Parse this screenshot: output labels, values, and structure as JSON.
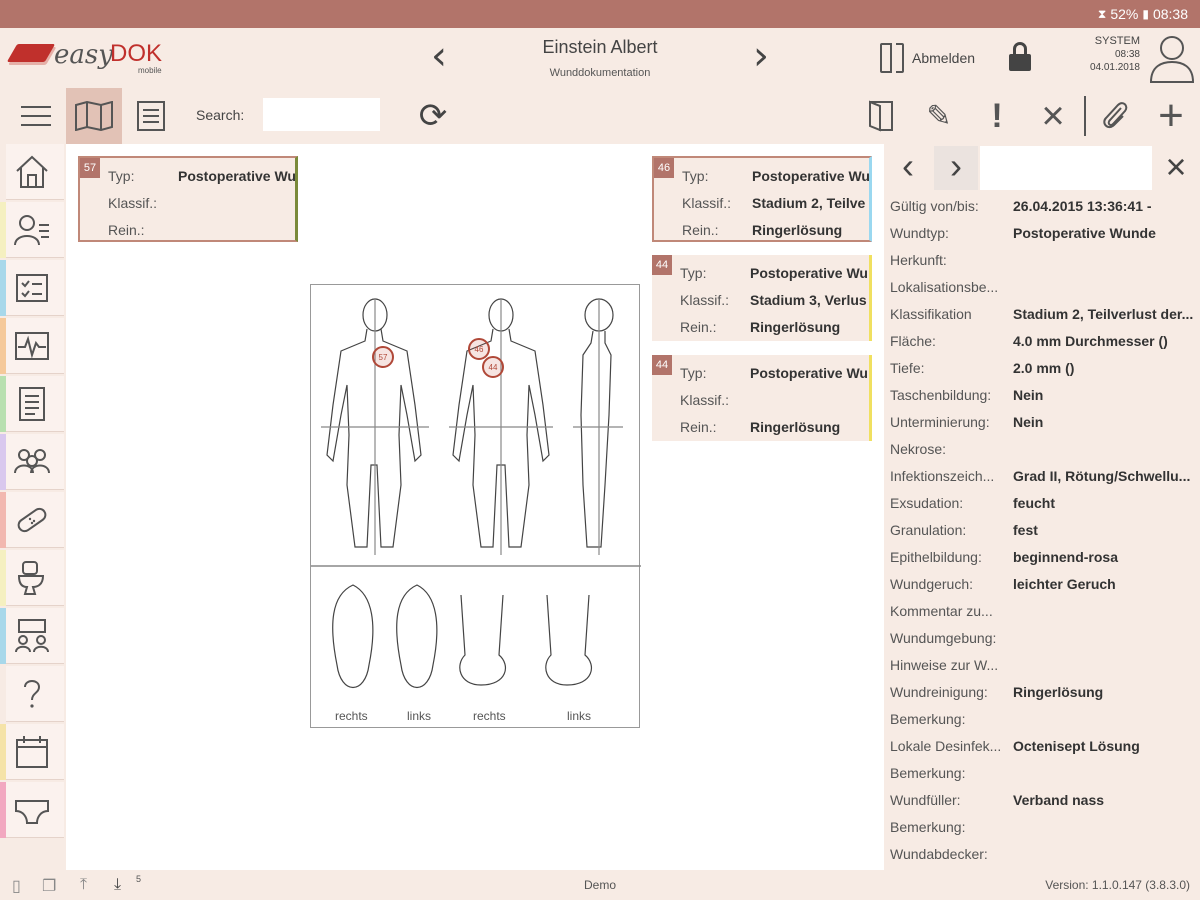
{
  "statusbar": {
    "battery": "52%",
    "time": "08:38"
  },
  "header": {
    "logo": {
      "easy": "easy",
      "dok": "DOK",
      "mobile": "mobile"
    },
    "patient_name": "Einstein Albert",
    "subtitle": "Wunddokumentation",
    "logout_label": "Abmelden",
    "user": "SYSTEM",
    "user_time": "08:38",
    "user_date": "04.01.2018"
  },
  "toolbar": {
    "search_label": "Search:",
    "search_value": ""
  },
  "sidebar": {
    "items": [
      {
        "icon": "home-icon",
        "color": "#f7ebe4"
      },
      {
        "icon": "patient-list-icon",
        "color": "#f5f0c0"
      },
      {
        "icon": "checklist-icon",
        "color": "#a8d8ea"
      },
      {
        "icon": "vital-signs-icon",
        "color": "#f5c99a"
      },
      {
        "icon": "document-icon",
        "color": "#b8e0b0"
      },
      {
        "icon": "group-icon",
        "color": "#d9c8ee"
      },
      {
        "icon": "bandage-icon",
        "color": "#f2b8b0"
      },
      {
        "icon": "toilet-icon",
        "color": "#f5f0c0"
      },
      {
        "icon": "organization-icon",
        "color": "#a8d8ea"
      },
      {
        "icon": "help-icon",
        "color": "#f7ebe4"
      },
      {
        "icon": "calendar-icon",
        "color": "#f5e3a8"
      },
      {
        "icon": "diaper-icon",
        "color": "#f2a8c0"
      }
    ]
  },
  "cards": [
    {
      "num": "57",
      "accent": "#7a8a3a",
      "rows": [
        {
          "label": "Typ:",
          "value": "Postoperative Wu"
        },
        {
          "label": "Klassif.:",
          "value": ""
        },
        {
          "label": "Rein.:",
          "value": ""
        }
      ]
    },
    {
      "num": "46",
      "accent": "#9ad8f0",
      "rows": [
        {
          "label": "Typ:",
          "value": "Postoperative Wu"
        },
        {
          "label": "Klassif.:",
          "value": "Stadium 2, Teilve"
        },
        {
          "label": "Rein.:",
          "value": "Ringerlösung"
        }
      ]
    },
    {
      "num": "44",
      "accent": "#f0e060",
      "rows": [
        {
          "label": "Typ:",
          "value": "Postoperative Wu"
        },
        {
          "label": "Klassif.:",
          "value": "Stadium 3, Verlus"
        },
        {
          "label": "Rein.:",
          "value": "Ringerlösung"
        }
      ]
    },
    {
      "num": "44",
      "accent": "#f0e060",
      "rows": [
        {
          "label": "Typ:",
          "value": "Postoperative Wu"
        },
        {
          "label": "Klassif.:",
          "value": ""
        },
        {
          "label": "Rein.:",
          "value": "Ringerlösung"
        }
      ]
    }
  ],
  "bodychart": {
    "markers": [
      {
        "num": "57"
      },
      {
        "num": "46"
      },
      {
        "num": "44"
      }
    ],
    "foot_labels": [
      "rechts",
      "links",
      "rechts",
      "links"
    ]
  },
  "detail": {
    "rows": [
      {
        "k": "Gültig von/bis:",
        "v": "26.04.2015 13:36:41 -"
      },
      {
        "k": "Wundtyp:",
        "v": "Postoperative Wunde"
      },
      {
        "k": "Herkunft:",
        "v": ""
      },
      {
        "k": "Lokalisationsbe...",
        "v": ""
      },
      {
        "k": "Klassifikation",
        "v": "Stadium 2, Teilverlust der..."
      },
      {
        "k": "Fläche:",
        "v": "4.0 mm Durchmesser ()"
      },
      {
        "k": "Tiefe:",
        "v": "2.0 mm ()"
      },
      {
        "k": "Taschenbildung:",
        "v": "Nein"
      },
      {
        "k": "Unterminierung:",
        "v": "Nein"
      },
      {
        "k": "Nekrose:",
        "v": ""
      },
      {
        "k": "Infektionszeich...",
        "v": "Grad II, Rötung/Schwellu..."
      },
      {
        "k": "Exsudation:",
        "v": "feucht"
      },
      {
        "k": "Granulation:",
        "v": "fest"
      },
      {
        "k": "Epithelbildung:",
        "v": "beginnend-rosa"
      },
      {
        "k": "Wundgeruch:",
        "v": "leichter Geruch"
      },
      {
        "k": "Kommentar zu...",
        "v": ""
      },
      {
        "k": "Wundumgebung:",
        "v": ""
      },
      {
        "k": "Hinweise zur W...",
        "v": ""
      },
      {
        "k": "Wundreinigung:",
        "v": "Ringerlösung"
      },
      {
        "k": "Bemerkung:",
        "v": ""
      },
      {
        "k": "Lokale Desinfek...",
        "v": "Octenisept Lösung"
      },
      {
        "k": "Bemerkung:",
        "v": ""
      },
      {
        "k": "Wundfüller:",
        "v": "Verband nass"
      },
      {
        "k": "Bemerkung:",
        "v": ""
      },
      {
        "k": "Wundabdecker:",
        "v": ""
      }
    ]
  },
  "footer": {
    "download_count": "5",
    "center": "Demo",
    "version": "Version:  1.1.0.147 (3.8.3.0)"
  }
}
